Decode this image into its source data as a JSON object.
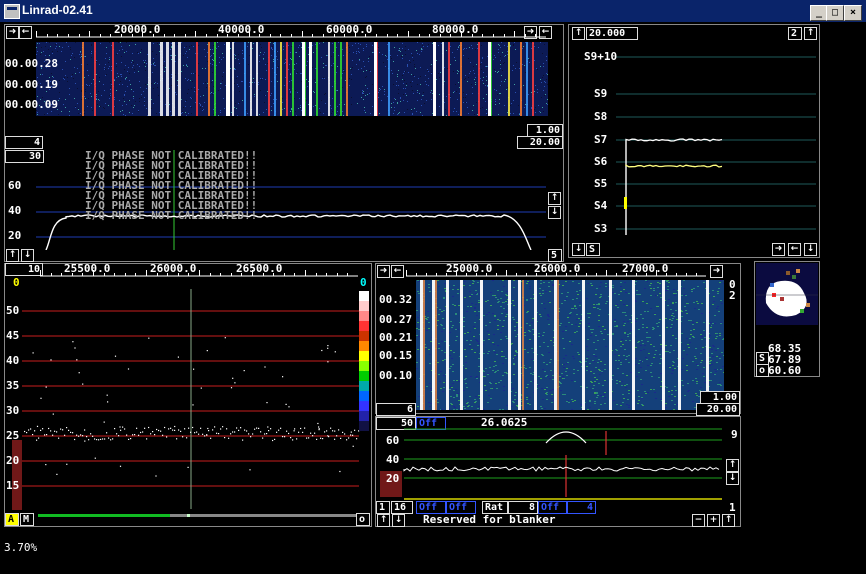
{
  "window": {
    "title": "Linrad-02.41",
    "min_label": "_",
    "max_label": "□",
    "close_label": "×"
  },
  "wide": {
    "freq_ticks": [
      "20000.0",
      "40000.0",
      "60000.0",
      "80000.0"
    ],
    "time_labels": [
      "00.00.28",
      "00.00.19",
      "00.00.09"
    ],
    "left_count": "4",
    "zoom1": "1.00",
    "zoom2": "20.00",
    "spec_count": "30",
    "spec_y_ticks": [
      "60",
      "40",
      "20"
    ],
    "warning": "I/Q PHASE NOT CALIBRATED!!",
    "right_count": "5"
  },
  "smeter": {
    "value_box": "20.000",
    "mode_box": "2",
    "scale": [
      "S9+10",
      "S9",
      "S8",
      "S7",
      "S6",
      "S5",
      "S4",
      "S3"
    ],
    "s_btn": "S"
  },
  "baseband": {
    "zoom_box": "10",
    "freq_ticks": [
      "25500.0",
      "26000.0",
      "26500.0"
    ],
    "left_top": "0",
    "right_top": "0",
    "y_ticks": [
      "50",
      "45",
      "40",
      "35",
      "30",
      "25",
      "20",
      "15"
    ],
    "a_btn": "A",
    "m_btn": "M",
    "o_btn": "o"
  },
  "hires": {
    "freq_ticks": [
      "25000.0",
      "26000.0",
      "27000.0"
    ],
    "time_labels": [
      "00.32",
      "00.27",
      "00.21",
      "00.15",
      "00.10"
    ],
    "side_top": "0",
    "side_mid": "2",
    "zoom1": "1.00",
    "zoom2": "20.00",
    "left_count": "6"
  },
  "afc": {
    "gain_box": "50",
    "off1": "Off",
    "freq": "26.0625",
    "right_num": "9",
    "y_ticks": [
      "60",
      "40",
      "20"
    ],
    "btn_1": "1",
    "btn_16": "16",
    "off2": "Off",
    "off3": "Off",
    "rat_label": "Rat",
    "rat_val": "8",
    "off4": "Off",
    "num4": "4",
    "reserved": "Reserved for blanker",
    "right_bottom": "1"
  },
  "pol": {
    "values": [
      "68.35",
      "67.89",
      "60.60"
    ],
    "s_btn": "S",
    "o_btn": "o"
  },
  "status": {
    "percent": "3.70%"
  },
  "colors": {
    "title_bar": "#0a246a",
    "grid_blue": "#1e3cb4",
    "grid_red": "#c81e1e",
    "grid_green": "#1ea01e",
    "trace": "#ffffff",
    "s_meter_line": "#ffff80"
  }
}
